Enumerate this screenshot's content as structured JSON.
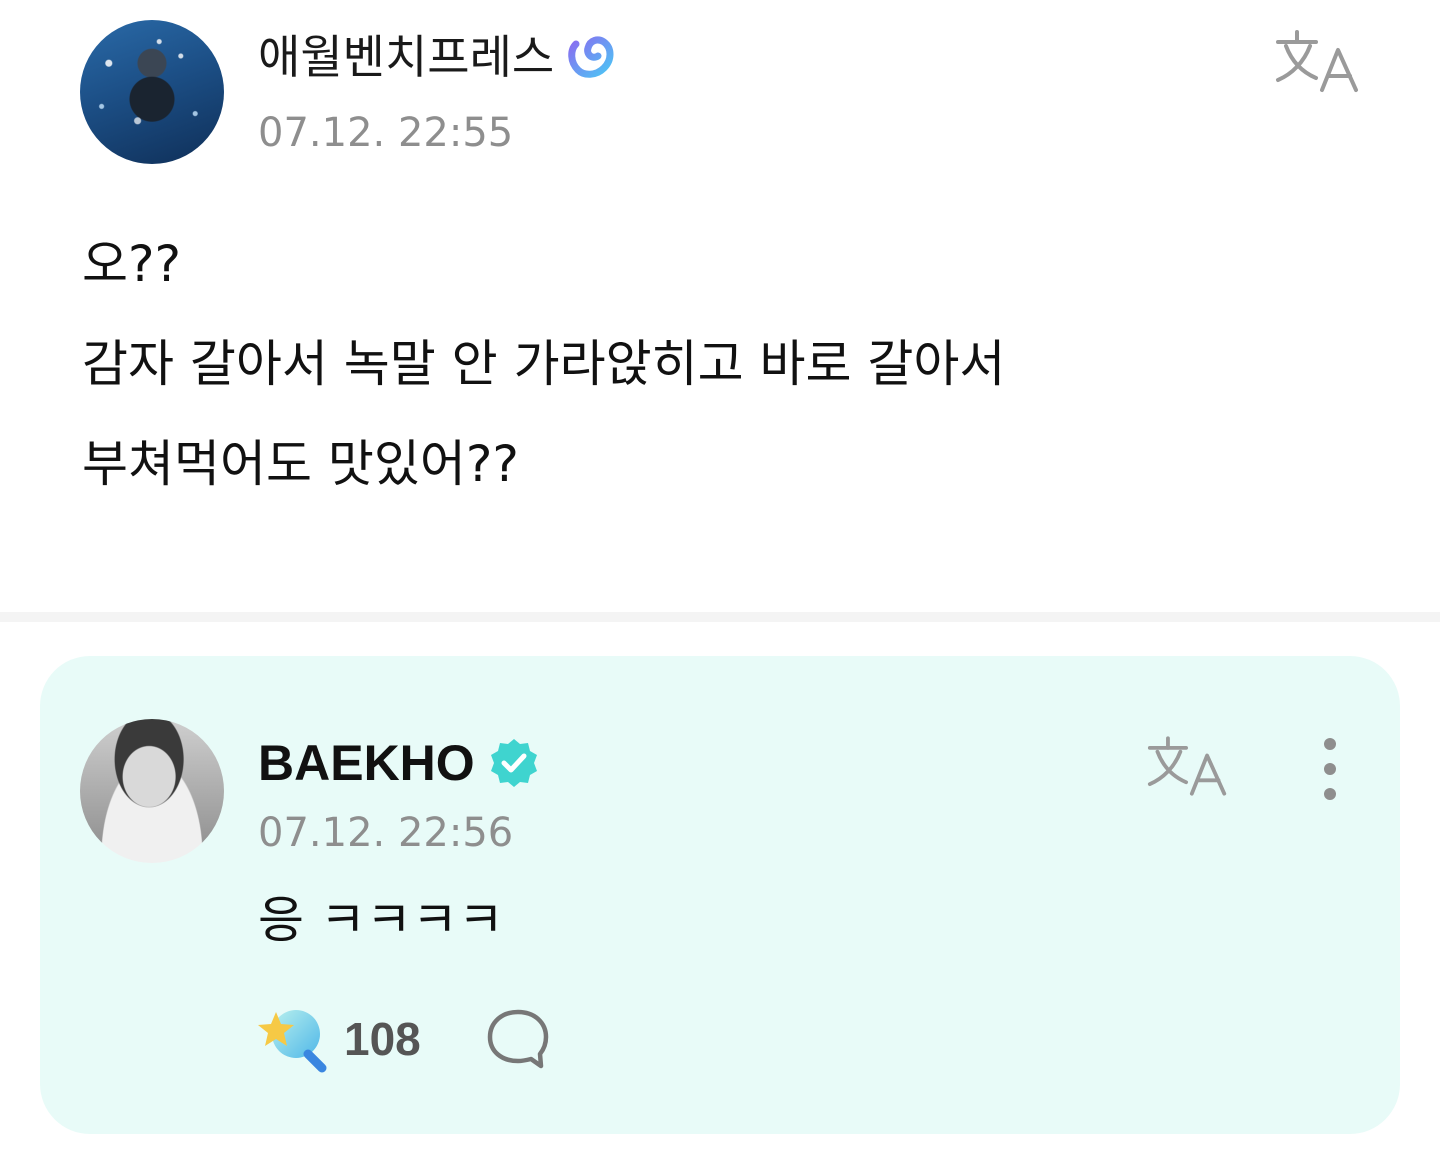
{
  "post": {
    "author": "애월벤치프레스",
    "timestamp": "07.12. 22:55",
    "lines": [
      "오??",
      "감자 갈아서 녹말 안 가라앉히고 바로 갈아서",
      "부쳐먹어도 맛있어??"
    ]
  },
  "reply": {
    "author": "BAEKHO",
    "timestamp": "07.12. 22:56",
    "text": "응 ㅋㅋㅋㅋ",
    "light_count": "108"
  },
  "colors": {
    "reply_background": "#e8fbf8",
    "verified": "#3fd4cf",
    "fan_badge_start": "#8a6cf0",
    "fan_badge_end": "#4cc6f5"
  },
  "icons": {
    "translate": "translate-icon",
    "more": "more-vertical-icon",
    "light": "lightstick-icon",
    "comment": "comment-bubble-icon"
  }
}
